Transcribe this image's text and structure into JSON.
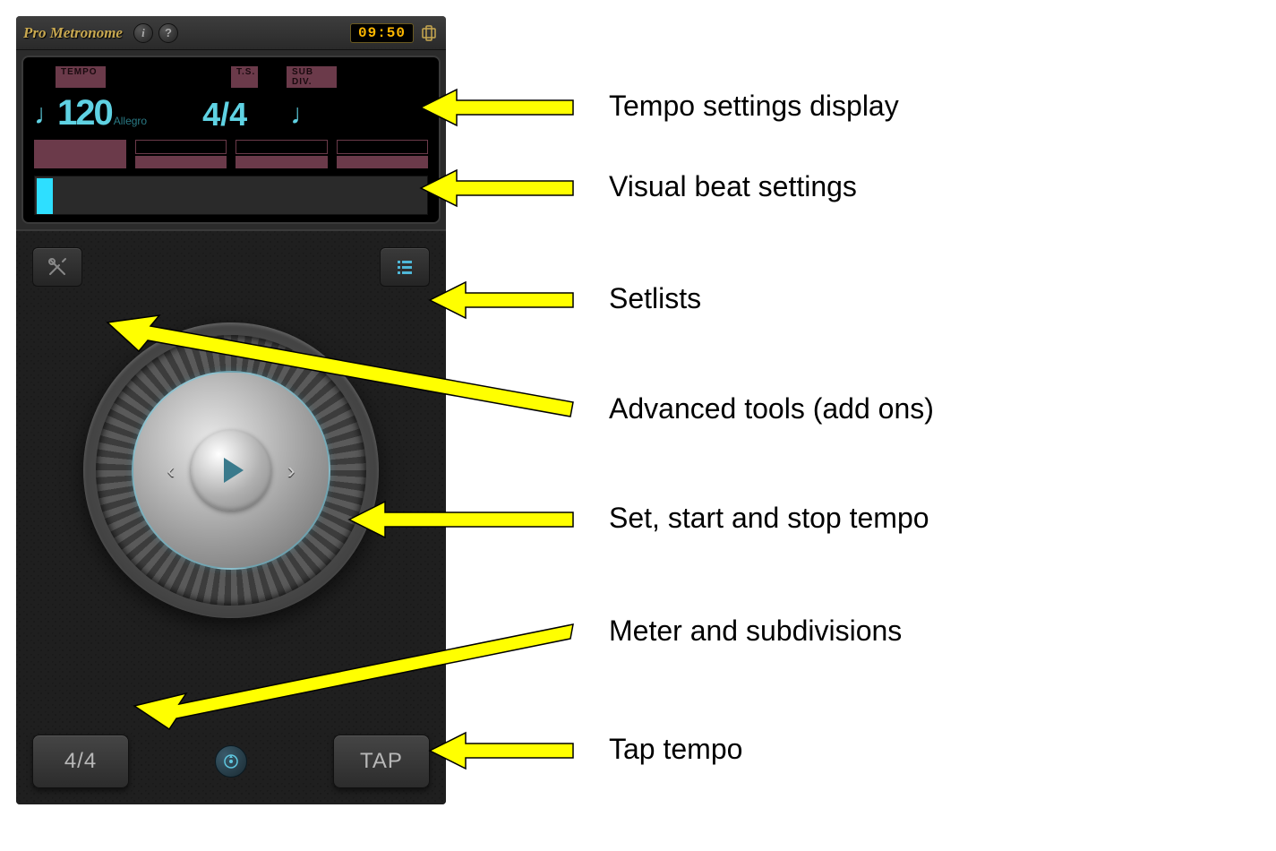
{
  "app_title": "Pro Metronome",
  "header": {
    "info_label": "i",
    "help_label": "?",
    "clock": "09:50"
  },
  "lcd": {
    "tempo_label": "TEMPO",
    "ts_label": "T.S.",
    "subdiv_label": "SUB DIV.",
    "tempo_value": "120",
    "tempo_name": "Allegro",
    "time_signature": "4/4",
    "note_glyph": "♩",
    "subdiv_glyph": "♩"
  },
  "bottom": {
    "meter_label": "4/4",
    "tap_label": "TAP"
  },
  "annotations": [
    {
      "label": "Tempo settings display"
    },
    {
      "label": "Visual beat settings"
    },
    {
      "label": "Setlists"
    },
    {
      "label": "Advanced tools (add ons)"
    },
    {
      "label": "Set, start and stop tempo"
    },
    {
      "label": "Meter and subdivisions"
    },
    {
      "label": "Tap tempo"
    }
  ]
}
